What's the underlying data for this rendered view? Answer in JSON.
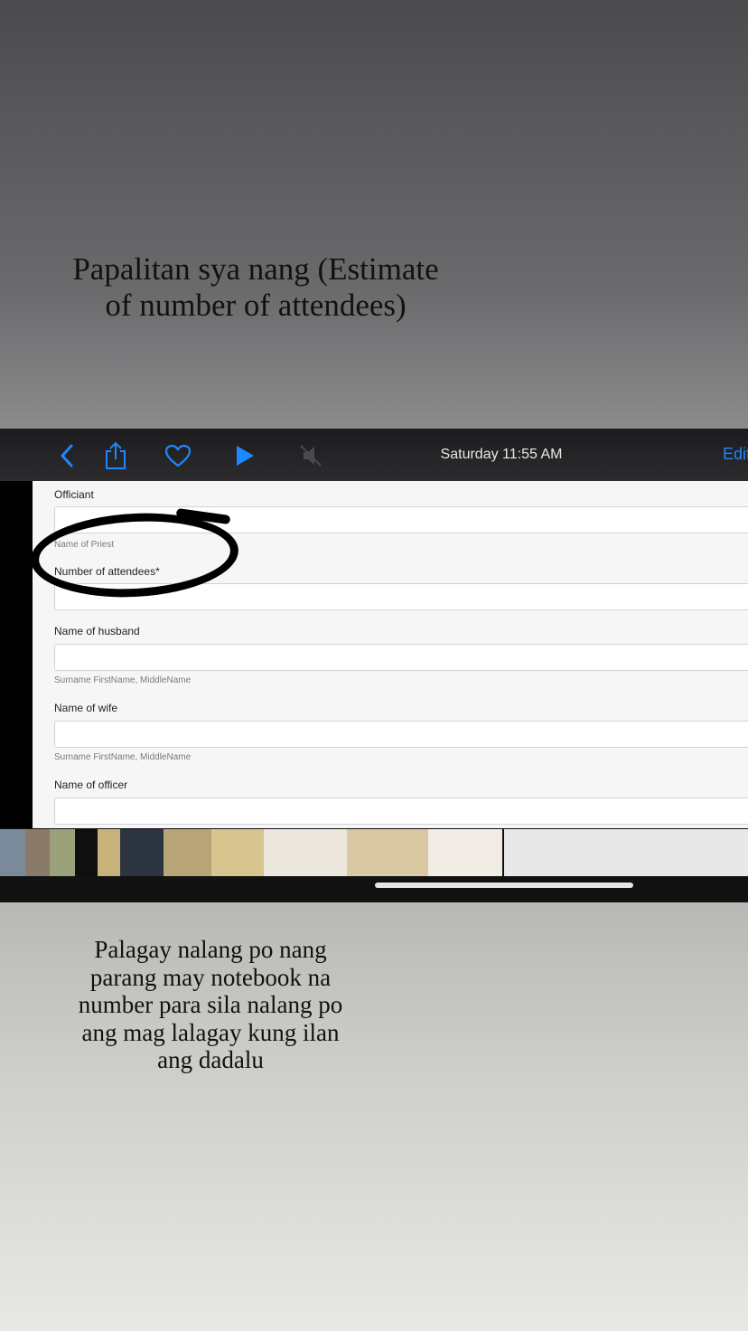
{
  "captions": {
    "top": "Papalitan sya nang (Estimate of number of attendees)",
    "bottom": "Palagay nalang po nang parang may notebook na number para sila nalang po ang mag lalagay kung ilan ang dadalu"
  },
  "toolbar": {
    "title": "Saturday  11:55 AM",
    "edit_label": "Edit",
    "accent_color": "#1e88ff",
    "icons": [
      "back-chevron-icon",
      "share-icon",
      "heart-icon",
      "play-icon",
      "muted-speaker-icon"
    ]
  },
  "form": {
    "fields": [
      {
        "label": "Officiant",
        "help": "Name of Priest",
        "value": ""
      },
      {
        "label": "Number of attendees*",
        "help": "",
        "value": ""
      },
      {
        "label": "Name of husband",
        "help": "Surname FirstName, MiddleName",
        "value": ""
      },
      {
        "label": "Name of wife",
        "help": "Surname FirstName, MiddleName",
        "value": ""
      },
      {
        "label": "Name of officer",
        "help": "",
        "value": ""
      }
    ]
  },
  "filmstrip": {
    "thumbnail_count": 12
  }
}
